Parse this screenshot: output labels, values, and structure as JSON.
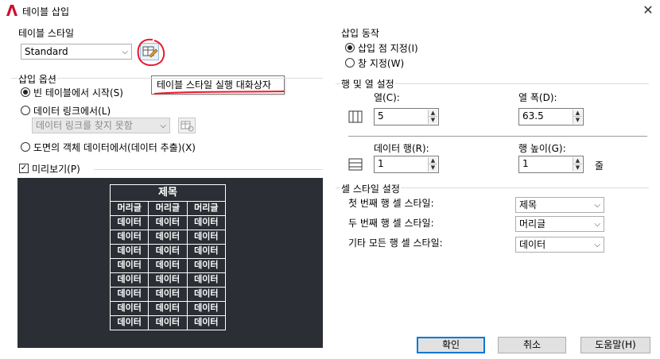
{
  "window": {
    "title": "테이블 삽입"
  },
  "table_style": {
    "group_label": "테이블 스타일",
    "selected": "Standard",
    "tooltip": "테이블 스타일 실행 대화상자"
  },
  "insert_options": {
    "group_label": "삽입 옵션",
    "empty_table_label": "빈 테이블에서 시작(S)",
    "data_link_label": "데이터 링크에서(L)",
    "data_link_placeholder": "데이터 링크를 찾지 못함",
    "drawing_data_label": "도면의 객체 데이터에서(데이터 추출)(X)"
  },
  "preview": {
    "checkbox_label": "미리보기(P)",
    "title": "제목",
    "header_cells": [
      "머리글",
      "머리글",
      "머리글"
    ],
    "data_cell": "데이터",
    "data_rows": 8
  },
  "insertion_behavior": {
    "group_label": "삽입 동작",
    "insertion_point_label": "삽입 점 지정(I)",
    "window_label": "창 지정(W)"
  },
  "column_row": {
    "group_label": "행 및 열 설정",
    "columns_label": "열(C):",
    "columns_value": "5",
    "column_width_label": "열 폭(D):",
    "column_width_value": "63.5",
    "data_rows_label": "데이터 행(R):",
    "data_rows_value": "1",
    "row_height_label": "행 높이(G):",
    "row_height_value": "1",
    "row_height_unit": "줄"
  },
  "cell_styles": {
    "group_label": "셀 스타일 설정",
    "first_row_label": "첫 번째 행 셀 스타일:",
    "first_row_value": "제목",
    "second_row_label": "두 번째 행 셀 스타일:",
    "second_row_value": "머리글",
    "other_rows_label": "기타 모든 행 셀 스타일:",
    "other_rows_value": "데이터"
  },
  "buttons": {
    "ok": "확인",
    "cancel": "취소",
    "help": "도움말(H)"
  },
  "colors": {
    "preview_bg": "#2b2f35",
    "brand": "#c8102e",
    "annotation": "#e8192c"
  }
}
